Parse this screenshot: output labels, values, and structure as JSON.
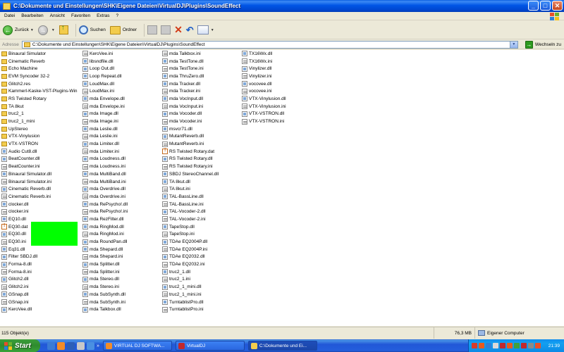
{
  "window": {
    "title": "C:\\Dokumente und Einstellungen\\SHK\\Eigene Dateien\\VirtualDJ\\Plugins\\SoundEffect",
    "buttons": {
      "minimize": "_",
      "maximize": "□",
      "close": "✕"
    }
  },
  "menu": [
    "Datei",
    "Bearbeiten",
    "Ansicht",
    "Favoriten",
    "Extras",
    "?"
  ],
  "toolbar": {
    "back_label": "Zurück",
    "search_label": "Suchen",
    "folders_label": "Ordner"
  },
  "address": {
    "label": "Adresse",
    "value": "C:\\Dokumente und Einstellungen\\SHK\\Eigene Dateien\\VirtualDJ\\Plugins\\SoundEffect",
    "go_label": "Wechseln zu"
  },
  "columns": [
    [
      {
        "name": "Binaural Simulator",
        "type": "folder"
      },
      {
        "name": "Cinematic Reverb",
        "type": "folder"
      },
      {
        "name": "Echo Machine",
        "type": "folder"
      },
      {
        "name": "EVM Syncoder 32-2",
        "type": "folder"
      },
      {
        "name": "Glitch2.res",
        "type": "folder"
      },
      {
        "name": "Kammerl-Kaske-VST-Plugins-Win",
        "type": "folder"
      },
      {
        "name": "RS Twisted Rotary",
        "type": "folder"
      },
      {
        "name": "TA 8kut",
        "type": "folder"
      },
      {
        "name": "truc2_1",
        "type": "folder"
      },
      {
        "name": "truc2_1_mini",
        "type": "folder"
      },
      {
        "name": "UpStereo",
        "type": "folder"
      },
      {
        "name": "VTX-Vinylusion",
        "type": "folder"
      },
      {
        "name": "VTX-VSTRON",
        "type": "folder"
      },
      {
        "name": "Audio Cut8.dll",
        "type": "dll"
      },
      {
        "name": "BeatCounter.dll",
        "type": "dll"
      },
      {
        "name": "BeatCounter.ini",
        "type": "ini"
      },
      {
        "name": "Binaural Simulator.dll",
        "type": "dll"
      },
      {
        "name": "Binaural Simulator.ini",
        "type": "ini"
      },
      {
        "name": "Cinematic Reverb.dll",
        "type": "dll"
      },
      {
        "name": "Cinematic Reverb.ini",
        "type": "ini"
      },
      {
        "name": "clocker.dll",
        "type": "dll"
      },
      {
        "name": "clocker.ini",
        "type": "ini"
      },
      {
        "name": "EQ10.dll",
        "type": "dll"
      },
      {
        "name": "EQ30.dat",
        "type": "dat"
      },
      {
        "name": "EQ30.dll",
        "type": "dll"
      },
      {
        "name": "EQ30.ini",
        "type": "ini"
      },
      {
        "name": "Eq31.dll",
        "type": "dll"
      },
      {
        "name": "Filter SBDJ.dll",
        "type": "dll"
      },
      {
        "name": "Forma-8.dll",
        "type": "dll"
      },
      {
        "name": "Forma-8.ini",
        "type": "ini"
      },
      {
        "name": "Glitch2.dll",
        "type": "dll"
      },
      {
        "name": "Glitch2.ini",
        "type": "ini"
      },
      {
        "name": "GSnap.dll",
        "type": "dll"
      },
      {
        "name": "GSnap.ini",
        "type": "ini"
      },
      {
        "name": "KeroVee.dll",
        "type": "dll"
      }
    ],
    [
      {
        "name": "KeroVee.ini",
        "type": "ini"
      },
      {
        "name": "libsndfile.dll",
        "type": "dll"
      },
      {
        "name": "Loop Out.dll",
        "type": "dll"
      },
      {
        "name": "Loop Repeat.dll",
        "type": "dll"
      },
      {
        "name": "LoudMax.dll",
        "type": "dll"
      },
      {
        "name": "LoudMax.ini",
        "type": "ini"
      },
      {
        "name": "mda Envelope.dll",
        "type": "dll"
      },
      {
        "name": "mda Envelope.ini",
        "type": "ini"
      },
      {
        "name": "mda Image.dll",
        "type": "dll"
      },
      {
        "name": "mda Image.ini",
        "type": "ini"
      },
      {
        "name": "mda Leslie.dll",
        "type": "dll"
      },
      {
        "name": "mda Leslie.ini",
        "type": "ini"
      },
      {
        "name": "mda Limiter.dll",
        "type": "dll"
      },
      {
        "name": "mda Limiter.ini",
        "type": "ini"
      },
      {
        "name": "mda Loudness.dll",
        "type": "dll"
      },
      {
        "name": "mda Loudness.ini",
        "type": "ini"
      },
      {
        "name": "mda MultiBand.dll",
        "type": "dll"
      },
      {
        "name": "mda MultiBand.ini",
        "type": "ini"
      },
      {
        "name": "mda Overdrive.dll",
        "type": "dll"
      },
      {
        "name": "mda Overdrive.ini",
        "type": "ini"
      },
      {
        "name": "mda RePsycho!.dll",
        "type": "dll"
      },
      {
        "name": "mda RePsycho!.ini",
        "type": "ini"
      },
      {
        "name": "mda RezFilter.dll",
        "type": "dll"
      },
      {
        "name": "mda RingMod.dll",
        "type": "dll"
      },
      {
        "name": "mda RingMod.ini",
        "type": "ini"
      },
      {
        "name": "mda RoundPan.dll",
        "type": "dll"
      },
      {
        "name": "mda Shepard.dll",
        "type": "dll"
      },
      {
        "name": "mda Shepard.ini",
        "type": "ini"
      },
      {
        "name": "mda Splitter.dll",
        "type": "dll"
      },
      {
        "name": "mda Splitter.ini",
        "type": "ini"
      },
      {
        "name": "mda Stereo.dll",
        "type": "dll"
      },
      {
        "name": "mda Stereo.ini",
        "type": "ini"
      },
      {
        "name": "mda SubSynth.dll",
        "type": "dll"
      },
      {
        "name": "mda SubSynth.ini",
        "type": "ini"
      },
      {
        "name": "mda Talkbox.dll",
        "type": "dll"
      }
    ],
    [
      {
        "name": "mda Talkbox.ini",
        "type": "ini"
      },
      {
        "name": "mda TestTone.dll",
        "type": "dll"
      },
      {
        "name": "mda TestTone.ini",
        "type": "ini"
      },
      {
        "name": "mda ThruZero.dll",
        "type": "dll"
      },
      {
        "name": "mda Tracker.dll",
        "type": "dll"
      },
      {
        "name": "mda Tracker.ini",
        "type": "ini"
      },
      {
        "name": "mda VocInput.dll",
        "type": "dll"
      },
      {
        "name": "mda VocInput.ini",
        "type": "ini"
      },
      {
        "name": "mda Vocoder.dll",
        "type": "dll"
      },
      {
        "name": "mda Vocoder.ini",
        "type": "ini"
      },
      {
        "name": "msvcr71.dll",
        "type": "dll"
      },
      {
        "name": "MutantReverb.dll",
        "type": "dll"
      },
      {
        "name": "MutantReverb.ini",
        "type": "ini"
      },
      {
        "name": "RS Twisted Rotary.dat",
        "type": "dat"
      },
      {
        "name": "RS Twisted Rotary.dll",
        "type": "dll"
      },
      {
        "name": "RS Twisted Rotary.ini",
        "type": "ini"
      },
      {
        "name": "SBDJ StereoChannel.dll",
        "type": "dll"
      },
      {
        "name": "TA 8kut.dll",
        "type": "dll"
      },
      {
        "name": "TA 8kut.ini",
        "type": "ini"
      },
      {
        "name": "TAL-BassLine.dll",
        "type": "dll"
      },
      {
        "name": "TAL-BassLine.ini",
        "type": "ini"
      },
      {
        "name": "TAL-Vocoder-2.dll",
        "type": "dll"
      },
      {
        "name": "TAL-Vocoder-2.ini",
        "type": "ini"
      },
      {
        "name": "TapeStop.dll",
        "type": "dll"
      },
      {
        "name": "TapeStop.ini",
        "type": "ini"
      },
      {
        "name": "TDAe EQ2004P.dll",
        "type": "dll"
      },
      {
        "name": "TDAe EQ2004P.ini",
        "type": "ini"
      },
      {
        "name": "TDAe EQ2032.dll",
        "type": "dll"
      },
      {
        "name": "TDAe EQ2032.ini",
        "type": "ini"
      },
      {
        "name": "truc2_1.dll",
        "type": "dll"
      },
      {
        "name": "truc2_1.ini",
        "type": "ini"
      },
      {
        "name": "truc2_1_mini.dll",
        "type": "dll"
      },
      {
        "name": "truc2_1_mini.ini",
        "type": "ini"
      },
      {
        "name": "TurntablistPro.dll",
        "type": "dll"
      },
      {
        "name": "TurntablistPro.ini",
        "type": "ini"
      }
    ],
    [
      {
        "name": "TX16Wx.dll",
        "type": "dll"
      },
      {
        "name": "TX16Wx.ini",
        "type": "ini"
      },
      {
        "name": "Vinylizer.dll",
        "type": "dll"
      },
      {
        "name": "Vinylizer.ini",
        "type": "ini"
      },
      {
        "name": "vocovee.dll",
        "type": "dll"
      },
      {
        "name": "vocovee.ini",
        "type": "ini"
      },
      {
        "name": "VTX-Vinylusion.dll",
        "type": "dll"
      },
      {
        "name": "VTX-Vinylusion.ini",
        "type": "ini"
      },
      {
        "name": "VTX-VSTRON.dll",
        "type": "dll"
      },
      {
        "name": "VTX-VSTRON.ini",
        "type": "ini"
      }
    ]
  ],
  "status": {
    "count": "115 Objekt(e)",
    "size": "76,3 MB",
    "location": "Eigener Computer"
  },
  "taskbar": {
    "start_label": "Start",
    "tasks": [
      "VIRTUAL DJ SOFTWA...",
      "VirtualDJ",
      "C:\\Dokumente und Ei..."
    ],
    "clock": "21:39"
  },
  "colors": {
    "highlight_block": "#00FF00"
  }
}
